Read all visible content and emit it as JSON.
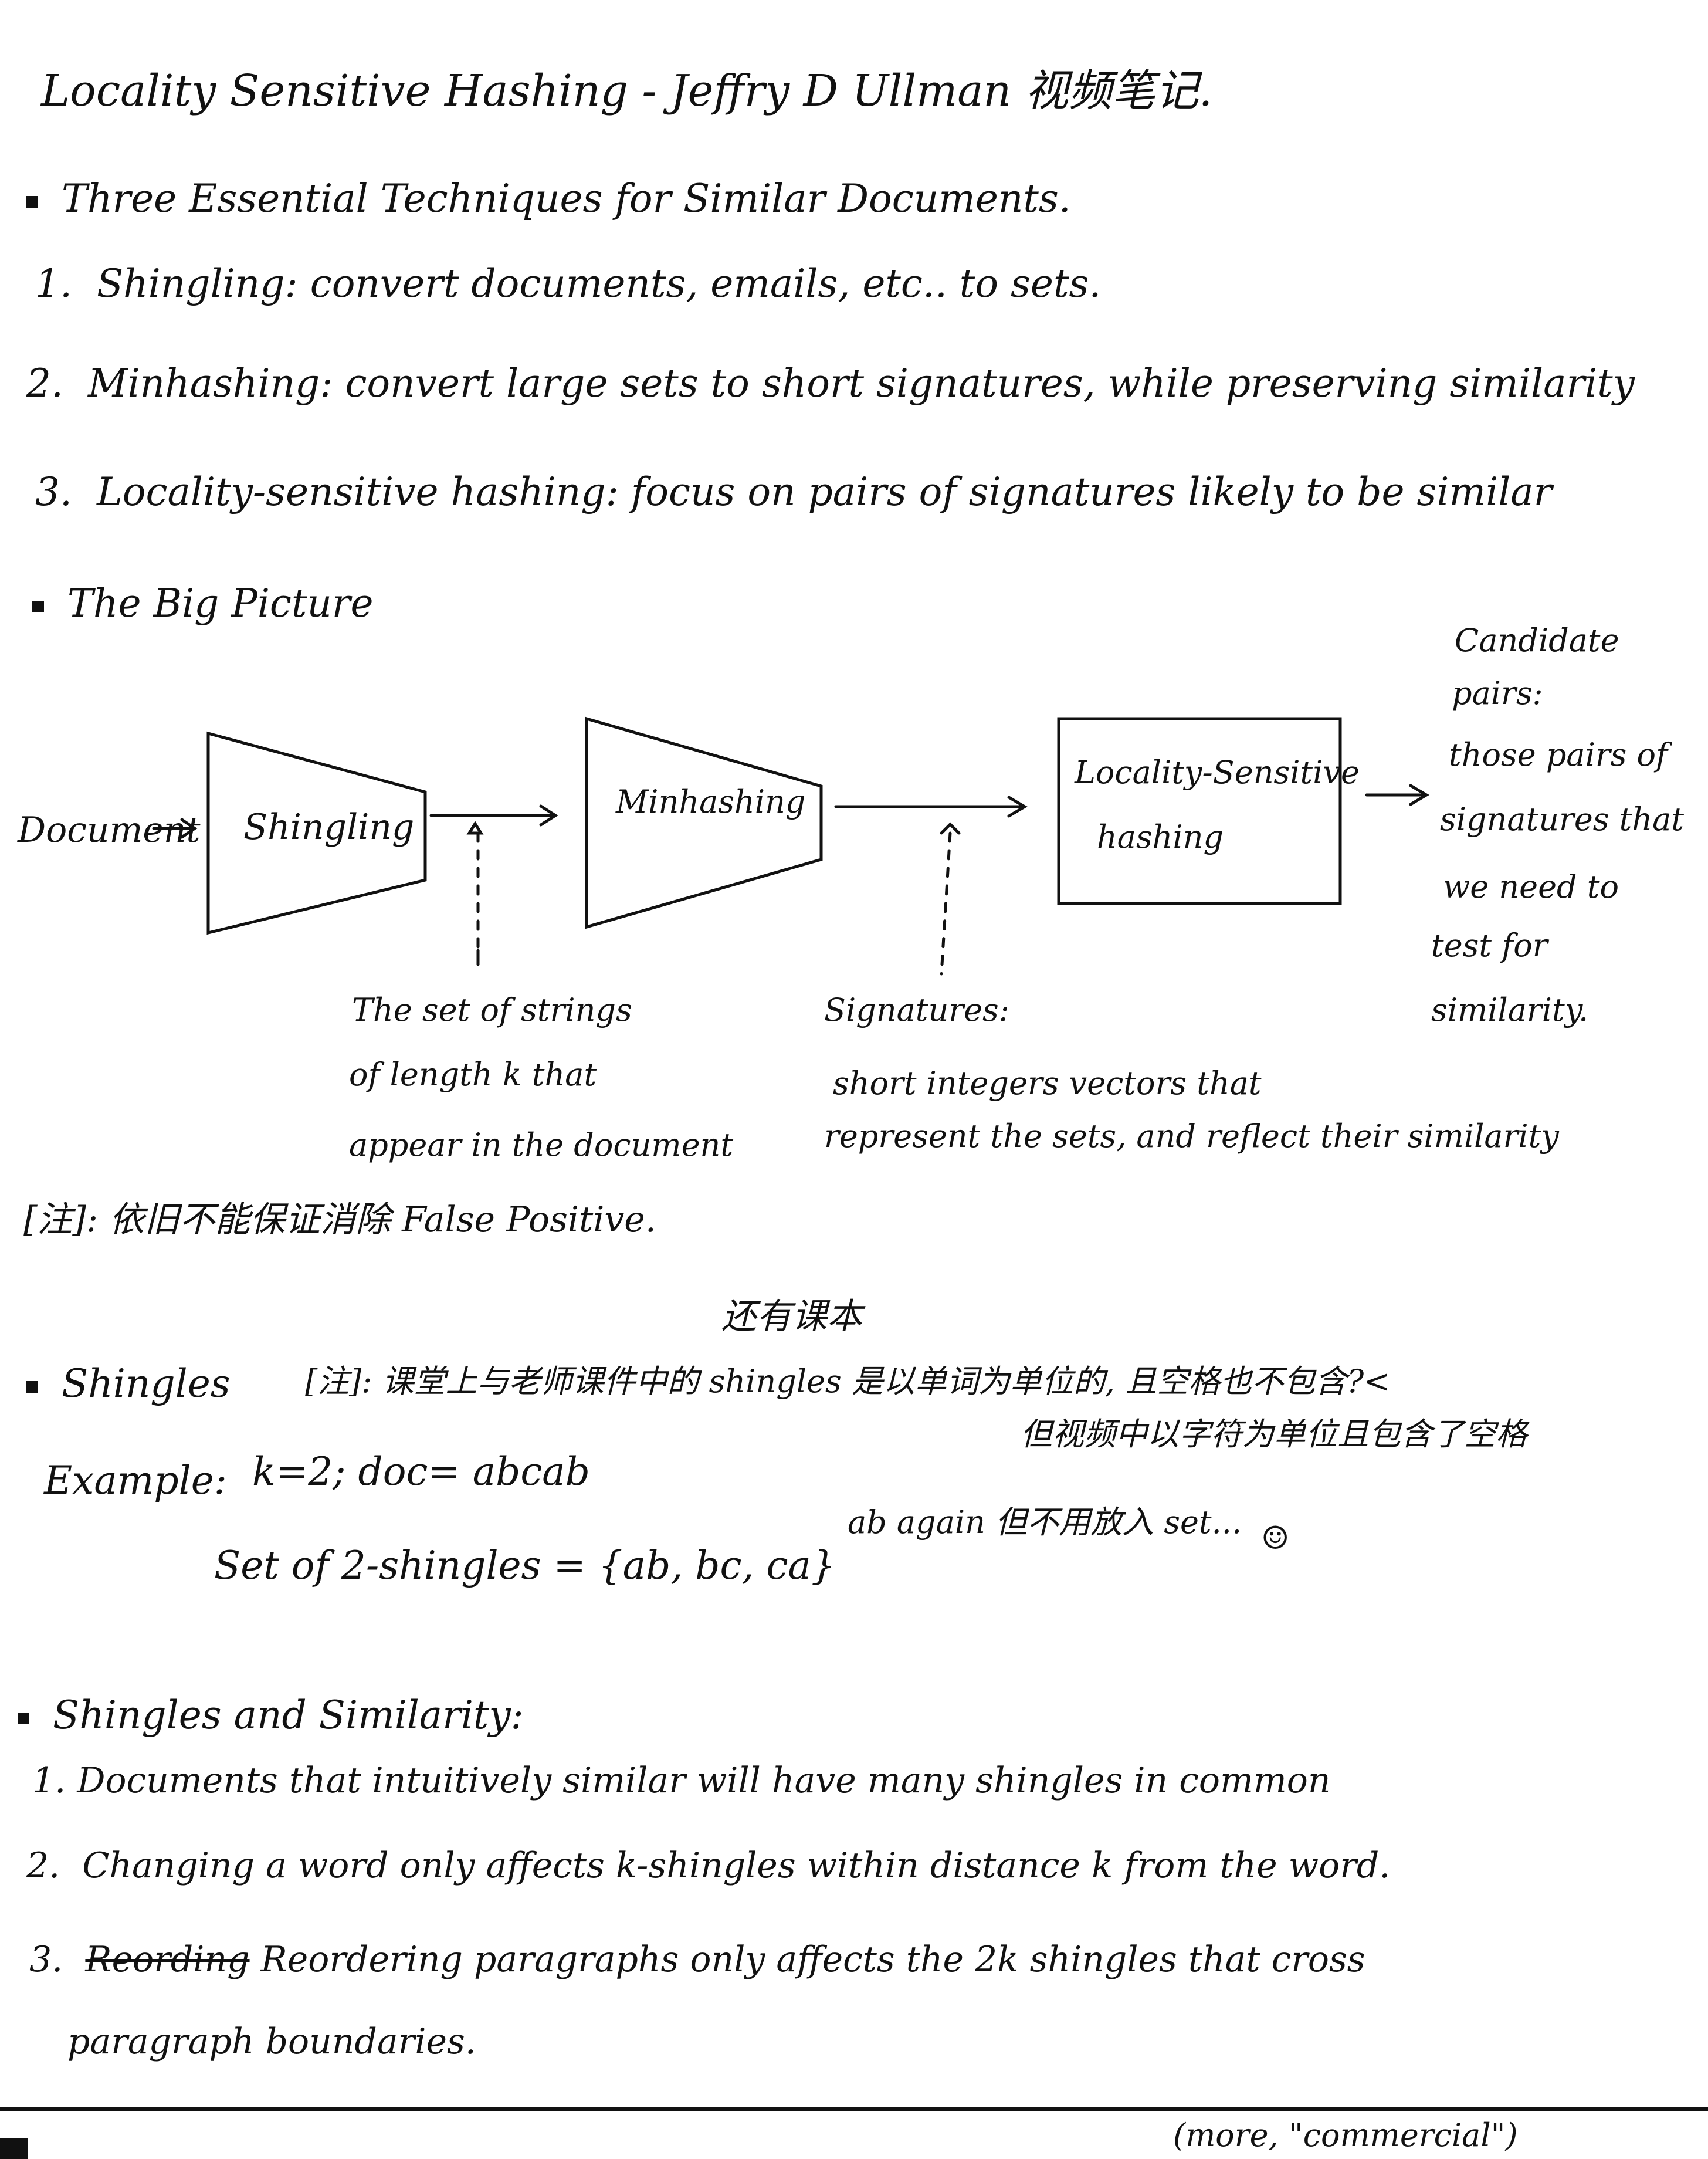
{
  "title": "Locality Sensitive Hashing - Jeffry D Ullman 视频笔记.",
  "techniques": {
    "heading": "Three Essential Techniques for Similar Documents.",
    "items": [
      {
        "num": "1.",
        "text": "Shingling: convert documents, emails, etc.. to sets."
      },
      {
        "num": "2.",
        "text": "Minhashing: convert large sets to short signatures, while preserving similarity"
      },
      {
        "num": "3.",
        "text": "Locality-sensitive hashing: focus on pairs of signatures likely to be similar"
      }
    ]
  },
  "big_picture": {
    "heading": "The Big Picture",
    "document_label": "Document",
    "shingling_label": "Shingling",
    "minhashing_label": "Minhashing",
    "lsh_label_line1": "Locality-Sensitive",
    "lsh_label_line2": "hashing",
    "candidate_lines": [
      "Candidate",
      "pairs:",
      "those pairs of",
      "signatures that",
      "we need to",
      "test for",
      "similarity."
    ],
    "shingle_note_lines": [
      "The set of strings",
      "of length k that",
      "appear in the document"
    ],
    "signature_note_lines": [
      "Signatures:",
      "short integers vectors that",
      "represent the sets, and reflect their similarity"
    ],
    "fp_note": "[注]: 依旧不能保证消除 False Positive."
  },
  "shingles": {
    "inserted_note": "还有课本",
    "heading": "Shingles",
    "note_line1": "[注]: 课堂上与老师课件中的 shingles 是以单词为单位的, 且空格也不包含?<",
    "note_line2": "但视频中以字符为单位且包含了空格",
    "example_label": "Example:",
    "example_params": "k=2; doc= abcab",
    "set_label": "Set of 2-shingles = {ab, bc, ca}",
    "aside": "ab again 但不用放入 set...",
    "smiley": "☺"
  },
  "similarity": {
    "heading": "Shingles and Similarity:",
    "items": [
      {
        "num": "1.",
        "text": "Documents that intuitively similar will have many shingles in common"
      },
      {
        "num": "2.",
        "text": "Changing a word only affects k-shingles within distance k from the word."
      },
      {
        "num": "3.",
        "struck": "Reording",
        "text": "Reordering paragraphs only affects the 2k shingles that cross"
      }
    ],
    "item3_cont": "paragraph boundaries."
  },
  "footer_note": "(more, \"commercial\")"
}
